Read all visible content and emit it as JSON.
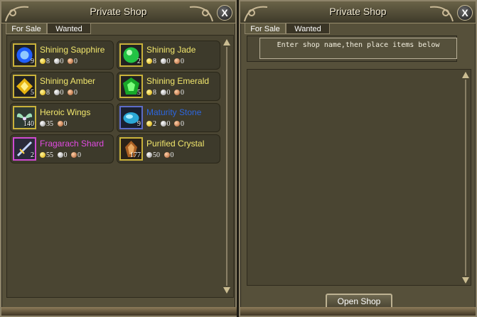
{
  "left_window": {
    "title": "Private Shop",
    "close": "X",
    "tabs": [
      {
        "label": "For Sale",
        "active": true
      },
      {
        "label": "Wanted",
        "active": false
      }
    ],
    "items": [
      {
        "name": "Shining Sapphire",
        "color": "#f1e66c",
        "qty": "9",
        "icon": "sapphire-icon",
        "icon_color": "#2266ff",
        "price": [
          {
            "coin": "gold",
            "value": "8"
          },
          {
            "coin": "silver",
            "value": "0"
          },
          {
            "coin": "copper",
            "value": "0"
          }
        ]
      },
      {
        "name": "Shining Jade",
        "color": "#f1e66c",
        "qty": "2",
        "icon": "jade-icon",
        "icon_color": "#2ad14a",
        "price": [
          {
            "coin": "gold",
            "value": "8"
          },
          {
            "coin": "silver",
            "value": "0"
          },
          {
            "coin": "copper",
            "value": "0"
          }
        ]
      },
      {
        "name": "Shining Amber",
        "color": "#f1e66c",
        "qty": "5",
        "icon": "amber-icon",
        "icon_color": "#e8b416",
        "price": [
          {
            "coin": "gold",
            "value": "8"
          },
          {
            "coin": "silver",
            "value": "0"
          },
          {
            "coin": "copper",
            "value": "0"
          }
        ]
      },
      {
        "name": "Shining Emerald",
        "color": "#f1e66c",
        "qty": "5",
        "icon": "emerald-icon",
        "icon_color": "#1bb32a",
        "price": [
          {
            "coin": "gold",
            "value": "8"
          },
          {
            "coin": "silver",
            "value": "0"
          },
          {
            "coin": "copper",
            "value": "0"
          }
        ]
      },
      {
        "name": "Heroic Wings",
        "color": "#f1e66c",
        "qty": "140",
        "icon": "wings-icon",
        "icon_color": "#7fd1a0",
        "price": [
          {
            "coin": "silver",
            "value": "35"
          },
          {
            "coin": "copper",
            "value": "0"
          }
        ]
      },
      {
        "name": "Maturity Stone",
        "color": "#2c66e0",
        "qty": "9",
        "icon": "stone-icon",
        "icon_color": "#40c8e8",
        "price": [
          {
            "coin": "gold",
            "value": "2"
          },
          {
            "coin": "silver",
            "value": "0"
          },
          {
            "coin": "copper",
            "value": "0"
          }
        ]
      },
      {
        "name": "Fragarach Shard",
        "color": "#e24be2",
        "qty": "2",
        "icon": "sword-icon",
        "icon_color": "#9ab4ff",
        "price": [
          {
            "coin": "gold",
            "value": "55"
          },
          {
            "coin": "silver",
            "value": "0"
          },
          {
            "coin": "copper",
            "value": "0"
          }
        ]
      },
      {
        "name": "Purified Crystal",
        "color": "#f1e66c",
        "qty": "177",
        "icon": "crystal-icon",
        "icon_color": "#b46a2a",
        "price": [
          {
            "coin": "silver",
            "value": "50"
          },
          {
            "coin": "copper",
            "value": "0"
          }
        ]
      }
    ]
  },
  "right_window": {
    "title": "Private Shop",
    "close": "X",
    "tabs": [
      {
        "label": "For Sale",
        "active": true
      },
      {
        "label": "Wanted",
        "active": false
      }
    ],
    "shop_name_placeholder": "Enter shop name,then place items below",
    "open_button": "Open Shop"
  },
  "colors": {
    "panel": "#56503a",
    "border": "#8e846a",
    "gold_text": "#f1e66c"
  }
}
